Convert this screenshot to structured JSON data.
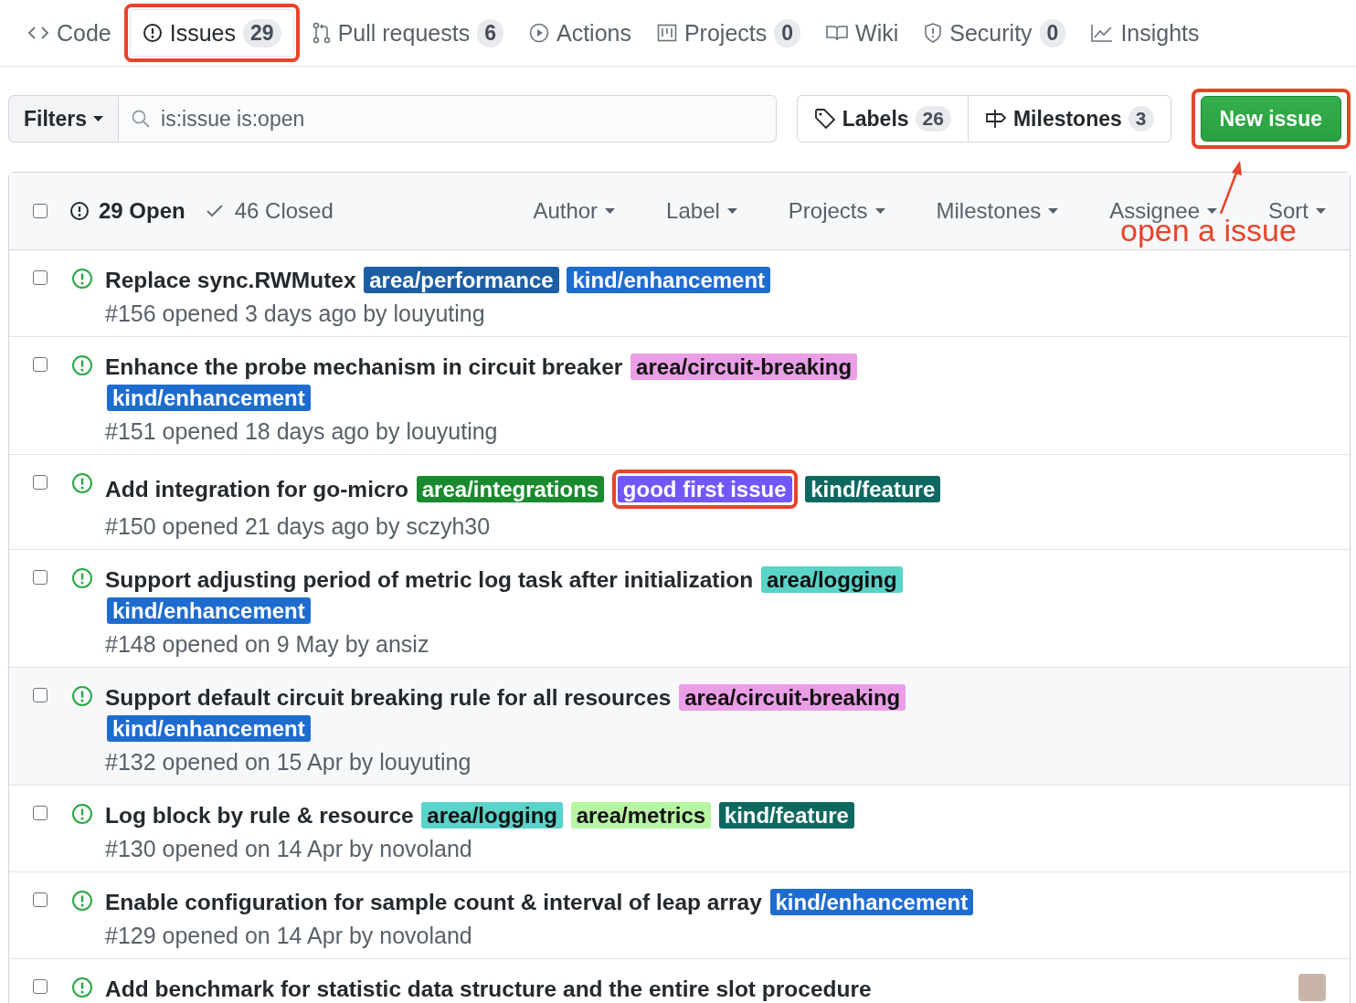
{
  "tabs": [
    {
      "kind": "code",
      "label": "Code",
      "selected": false,
      "highlighted": false
    },
    {
      "kind": "issue",
      "label": "Issues",
      "count": "29",
      "selected": true,
      "highlighted": true
    },
    {
      "kind": "pr",
      "label": "Pull requests",
      "count": "6",
      "selected": false,
      "highlighted": false
    },
    {
      "kind": "play",
      "label": "Actions",
      "selected": false,
      "highlighted": false
    },
    {
      "kind": "project",
      "label": "Projects",
      "count": "0",
      "selected": false,
      "highlighted": false
    },
    {
      "kind": "book",
      "label": "Wiki",
      "selected": false,
      "highlighted": false
    },
    {
      "kind": "shield",
      "label": "Security",
      "count": "0",
      "selected": false,
      "highlighted": false
    },
    {
      "kind": "graph",
      "label": "Insights",
      "selected": false,
      "highlighted": false
    }
  ],
  "toolbar": {
    "filters_button": "Filters",
    "search": {
      "value": "is:issue is:open"
    },
    "labels": {
      "label": "Labels",
      "count": "26"
    },
    "milestones": {
      "label": "Milestones",
      "count": "3"
    },
    "new_issue": {
      "label": "New issue",
      "highlighted": true
    }
  },
  "list_header": {
    "checked": false,
    "open": "29 Open",
    "closed": "46 Closed",
    "filters": [
      "Author",
      "Label",
      "Projects",
      "Milestones",
      "Assignee",
      "Sort"
    ]
  },
  "issues": [
    {
      "title": "Replace sync.RWMutex",
      "checked": false,
      "meta": "#156 opened 3 days ago by louyuting",
      "hovered": false,
      "labels": [
        {
          "name": "area/performance",
          "color": "#1d5ea3",
          "highlighted": false
        },
        {
          "name": "kind/enhancement",
          "color": "#1f6ccf",
          "highlighted": false
        }
      ]
    },
    {
      "title": "Enhance the probe mechanism in circuit breaker",
      "checked": false,
      "meta": "#151 opened 18 days ago by louyuting",
      "hovered": false,
      "labels": [
        {
          "name": "area/circuit-breaking",
          "color": "#ea9ee6",
          "highlighted": false
        },
        {
          "name": "kind/enhancement",
          "color": "#1f6ccf",
          "highlighted": false
        }
      ]
    },
    {
      "title": "Add integration for go-micro",
      "checked": false,
      "meta": "#150 opened 21 days ago by sczyh30",
      "hovered": false,
      "labels": [
        {
          "name": "area/integrations",
          "color": "#1a8a2e",
          "highlighted": false
        },
        {
          "name": "good first issue",
          "color": "#7057ff",
          "highlighted": true
        },
        {
          "name": "kind/feature",
          "color": "#0d6960",
          "highlighted": false
        }
      ]
    },
    {
      "title": "Support adjusting period of metric log task after initialization",
      "checked": false,
      "meta": "#148 opened on 9 May by ansiz",
      "hovered": false,
      "labels": [
        {
          "name": "area/logging",
          "color": "#5ad3c9",
          "highlighted": false
        },
        {
          "name": "kind/enhancement",
          "color": "#1f6ccf",
          "highlighted": false
        }
      ]
    },
    {
      "title": "Support default circuit breaking rule for all resources",
      "checked": false,
      "meta": "#132 opened on 15 Apr by louyuting",
      "hovered": true,
      "labels": [
        {
          "name": "area/circuit-breaking",
          "color": "#ea9ee6",
          "highlighted": false
        },
        {
          "name": "kind/enhancement",
          "color": "#1f6ccf",
          "highlighted": false
        }
      ]
    },
    {
      "title": "Log block by rule & resource",
      "checked": false,
      "meta": "#130 opened on 14 Apr by novoland",
      "hovered": false,
      "labels": [
        {
          "name": "area/logging",
          "color": "#5ad3c9",
          "highlighted": false
        },
        {
          "name": "area/metrics",
          "color": "#b7f5a3",
          "highlighted": false
        },
        {
          "name": "kind/feature",
          "color": "#0d6960",
          "highlighted": false
        }
      ]
    },
    {
      "title": "Enable configuration for sample count & interval of leap array",
      "checked": false,
      "meta": "#129 opened on 14 Apr by novoland",
      "hovered": false,
      "labels": [
        {
          "name": "kind/enhancement",
          "color": "#1f6ccf",
          "highlighted": false
        }
      ]
    },
    {
      "title": "Add benchmark for statistic data structure and the entire slot procedure",
      "checked": false,
      "hovered": false,
      "assignee_avatar": true
    }
  ],
  "annotation": {
    "text": "open a issue"
  }
}
